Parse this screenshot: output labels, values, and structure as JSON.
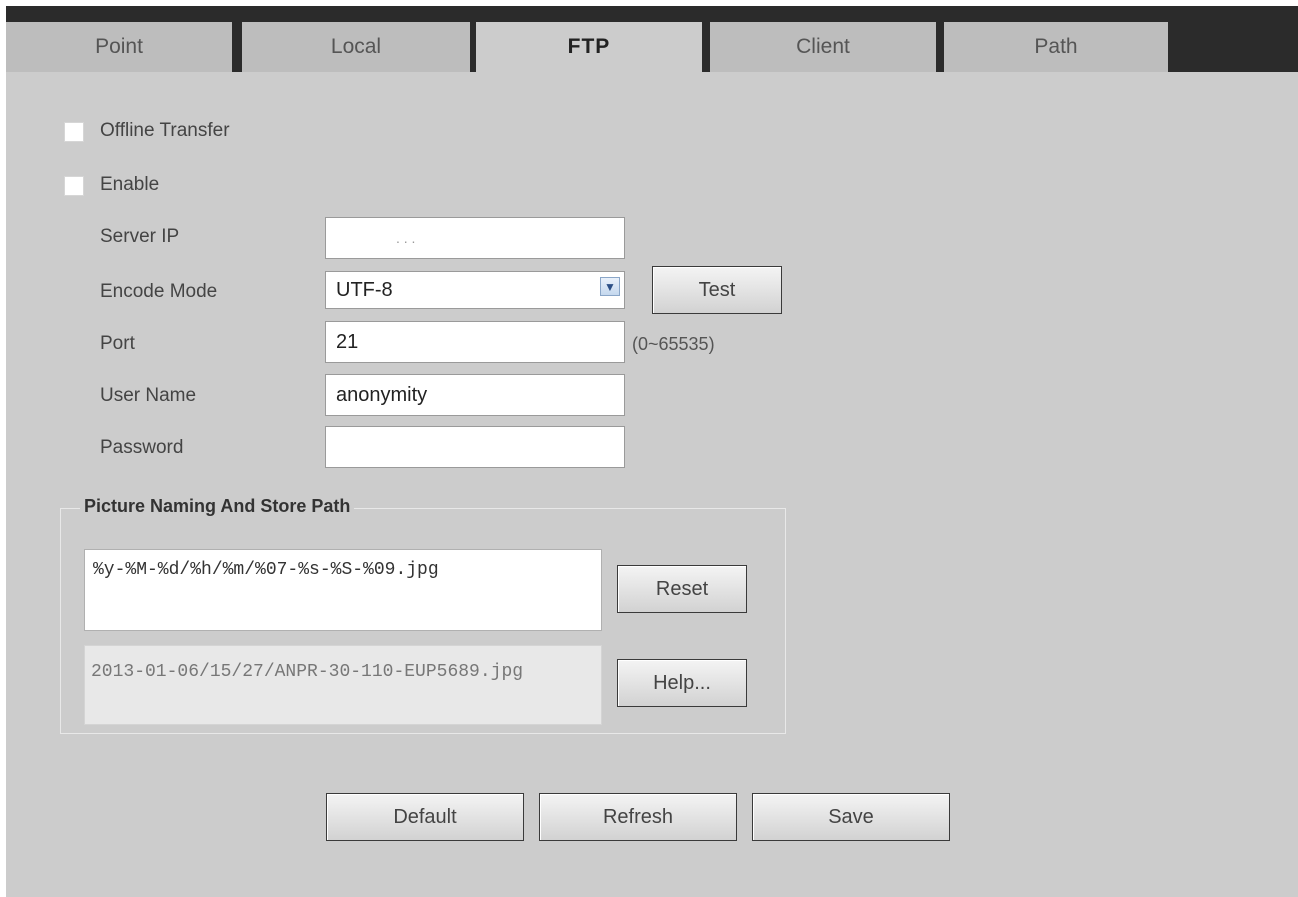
{
  "tabs": [
    {
      "label": "Point",
      "active": false
    },
    {
      "label": "Local",
      "active": false
    },
    {
      "label": "FTP",
      "active": true
    },
    {
      "label": "Client",
      "active": false
    },
    {
      "label": "Path",
      "active": false
    }
  ],
  "offline_transfer": {
    "label": "Offline Transfer",
    "checked": false
  },
  "enable": {
    "label": "Enable",
    "checked": false
  },
  "form": {
    "server_ip": {
      "label": "Server IP",
      "value": ".        .        ."
    },
    "encode_mode": {
      "label": "Encode Mode",
      "value": "UTF-8"
    },
    "port": {
      "label": "Port",
      "value": "21",
      "range": "(0~65535)"
    },
    "user_name": {
      "label": "User Name",
      "value": "anonymity"
    },
    "password": {
      "label": "Password",
      "value": ""
    }
  },
  "test_button": "Test",
  "naming": {
    "title": "Picture Naming And Store Path",
    "pattern": "%y-%M-%d/%h/%m/%07-%s-%S-%09.jpg",
    "preview": "2013-01-06/15/27/ANPR-30-110-EUP5689.jpg",
    "reset_button": "Reset",
    "help_button": "Help..."
  },
  "footer": {
    "default_button": "Default",
    "refresh_button": "Refresh",
    "save_button": "Save"
  },
  "colors": {
    "panel_bg": "#cccccc",
    "tab_inactive": "#bdbdbd",
    "tab_border": "#2b2b2b"
  }
}
